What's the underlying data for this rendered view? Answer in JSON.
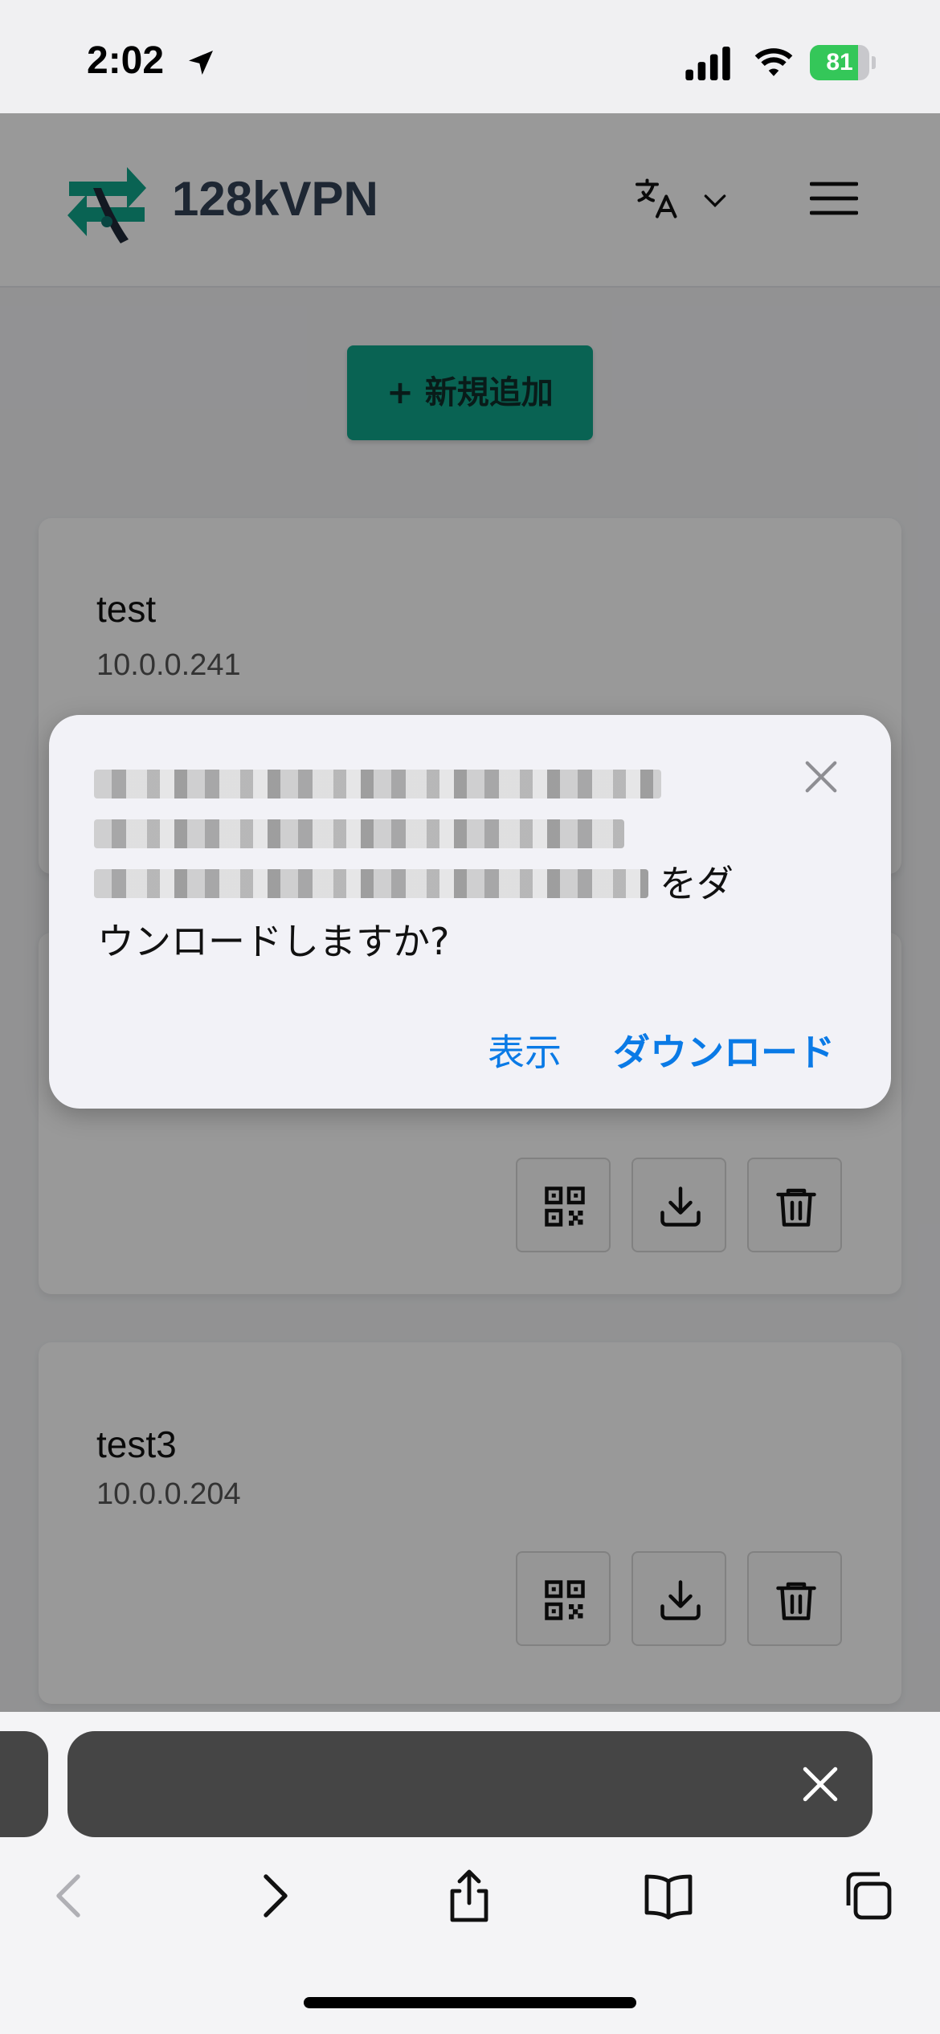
{
  "status_bar": {
    "time": "2:02",
    "battery": "81",
    "battery_level": 0.81
  },
  "header": {
    "brand": "128kVPN"
  },
  "add_button": {
    "label": "+ 新規追加"
  },
  "clients": [
    {
      "name": "test",
      "ip": "10.0.0.241"
    },
    {
      "name": "test3",
      "ip": "10.0.0.204"
    }
  ],
  "dialog": {
    "suffix_line1": "をダ",
    "line2": "ウンロードしますか?",
    "view_label": "表示",
    "download_label": "ダウンロード"
  },
  "colors": {
    "accent": "#10a58a",
    "link": "#0a7ae6",
    "battery": "#34c759"
  },
  "icons": {
    "status": [
      "location-arrow-icon",
      "cellular-signal-icon",
      "wifi-icon",
      "battery-icon"
    ],
    "header": [
      "translate-icon",
      "chevron-down-icon",
      "hamburger-menu-icon"
    ],
    "card": [
      "qr-code-icon",
      "download-icon",
      "trash-icon"
    ],
    "toolbar": [
      "back-icon",
      "forward-icon",
      "share-icon",
      "bookmarks-icon",
      "tabs-icon"
    ]
  }
}
